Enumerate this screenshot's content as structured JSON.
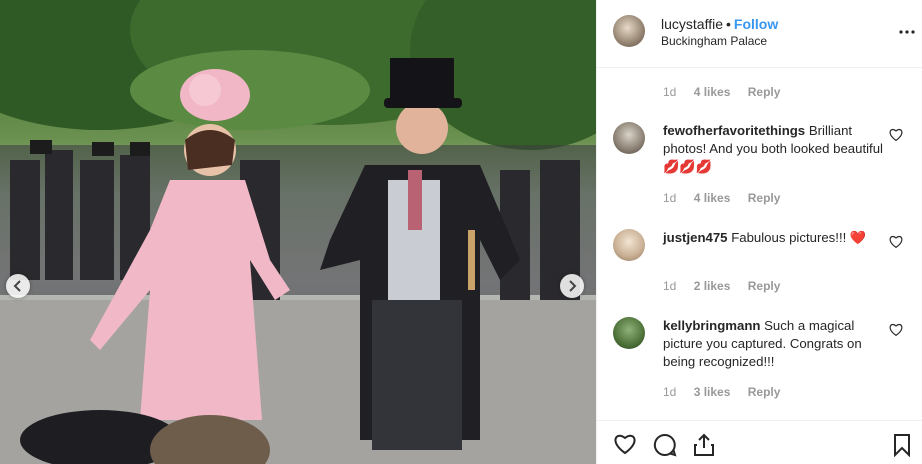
{
  "post": {
    "username": "lucystaffie",
    "separator": "•",
    "follow_label": "Follow",
    "location": "Buckingham Palace"
  },
  "top_meta": {
    "time": "1d",
    "likes": "4 likes",
    "reply": "Reply"
  },
  "comments": [
    {
      "username": "fewofherfavoritethings",
      "text": "Brilliant photos! And you both looked beautiful 💋💋💋",
      "time": "1d",
      "likes": "4 likes",
      "reply": "Reply"
    },
    {
      "username": "justjen475",
      "text": "Fabulous pictures!!! ❤️",
      "time": "1d",
      "likes": "2 likes",
      "reply": "Reply"
    },
    {
      "username": "kellybringmann",
      "text": "Such a magical picture you captured. Congrats on being recognized!!!",
      "time": "1d",
      "likes": "3 likes",
      "reply": "Reply"
    }
  ],
  "colors": {
    "follow": "#3897f0",
    "muted": "#999999",
    "text": "#262626",
    "border": "#efefef"
  },
  "icons": [
    "chevron-left-icon",
    "chevron-right-icon",
    "more-icon",
    "heart-icon",
    "comment-icon",
    "share-icon",
    "bookmark-icon"
  ]
}
